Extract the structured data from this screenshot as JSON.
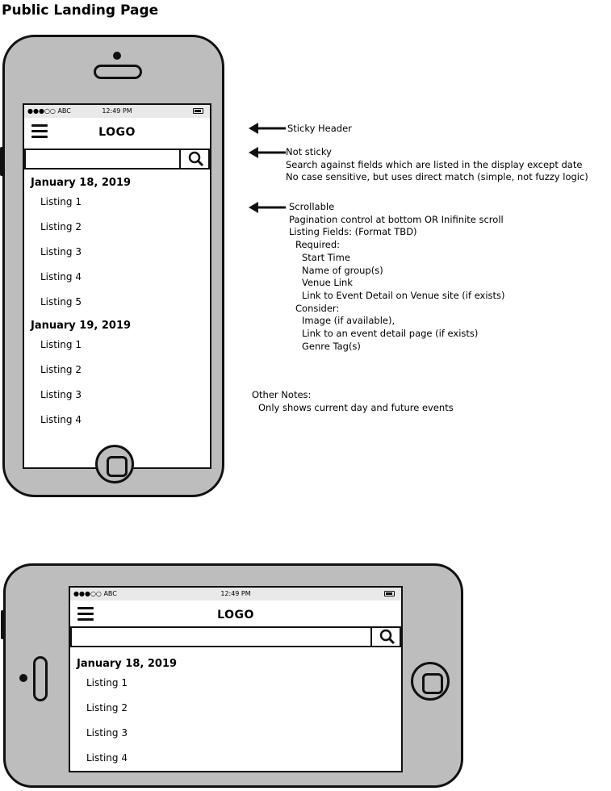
{
  "page_title": "Public Landing Page",
  "phone_ui": {
    "status_carrier": "●●●○○ ABC",
    "status_time": "12:49 PM",
    "logo": "LOGO",
    "search_placeholder": ""
  },
  "portrait_listings": [
    {
      "date": "January 18, 2019",
      "items": [
        "Listing 1",
        "Listing 2",
        "Listing 3",
        "Listing 4",
        "Listing 5"
      ]
    },
    {
      "date": "January 19, 2019",
      "items": [
        "Listing 1",
        "Listing 2",
        "Listing 3",
        "Listing 4"
      ]
    }
  ],
  "landscape_listings": [
    {
      "date": "January 18, 2019",
      "items": [
        "Listing 1",
        "Listing 2",
        "Listing 3",
        "Listing 4"
      ]
    }
  ],
  "annotations": {
    "sticky_header": "Sticky Header",
    "not_sticky": [
      "Not sticky",
      "Search against fields which are listed in the display except date",
      "No case sensitive, but uses direct match (simple, not fuzzy logic)"
    ],
    "scrollable": [
      "Scrollable",
      "Pagination control at bottom OR Inifinite scroll",
      "Listing Fields: (Format TBD)"
    ],
    "required_label": "Required:",
    "required_fields": [
      "Start Time",
      "Name of group(s)",
      "Venue Link",
      "Link to Event Detail on Venue site (if exists)"
    ],
    "consider_label": "Consider:",
    "consider_fields": [
      "Image (if available),",
      "Link to an event detail page (if exists)",
      "Genre Tag(s)"
    ],
    "other_notes_title": "Other Notes:",
    "other_notes": "Only shows current day and future events"
  }
}
